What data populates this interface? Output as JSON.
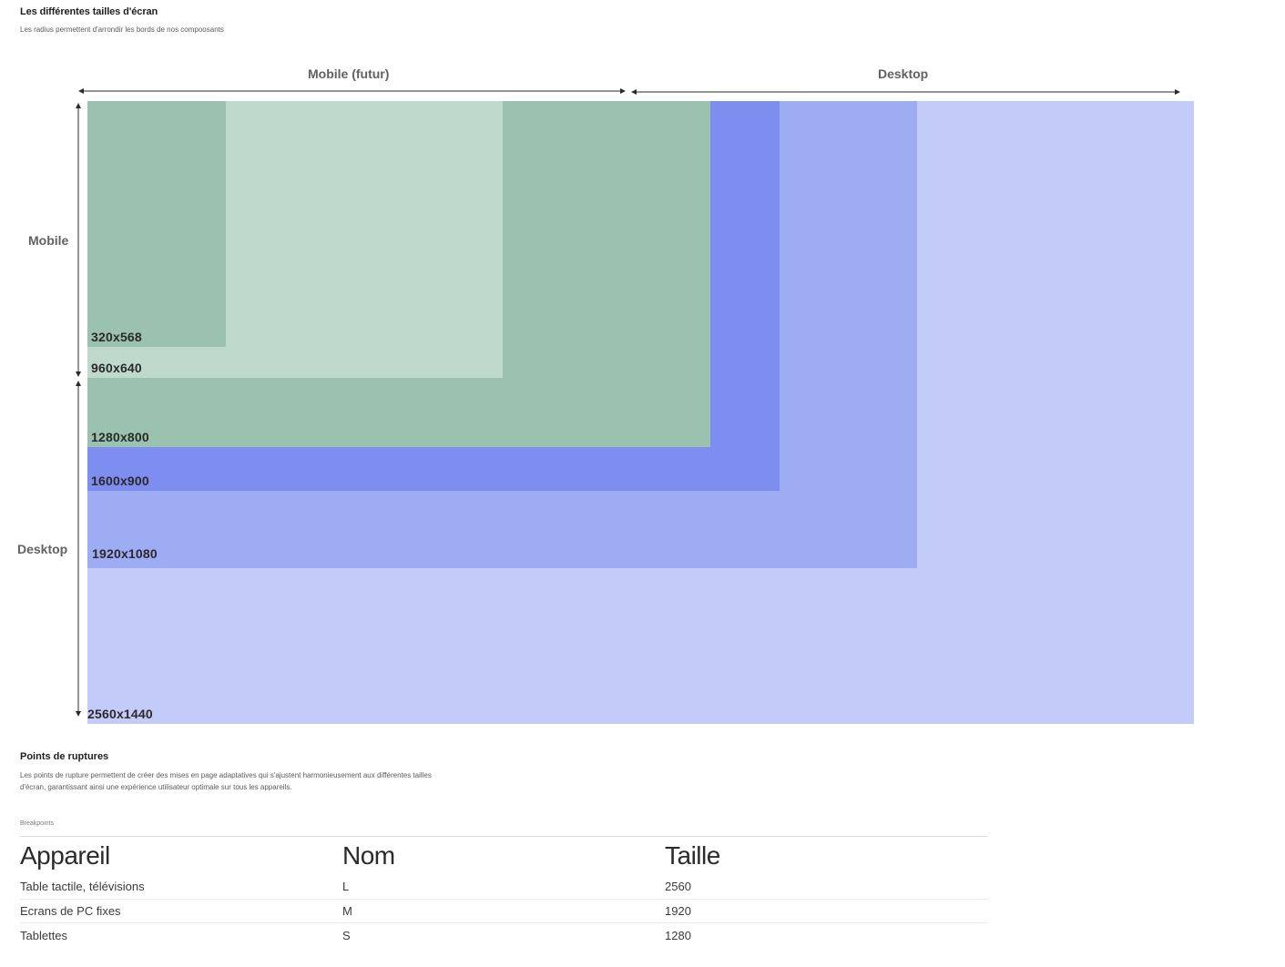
{
  "header": {
    "title": "Les différentes tailles d'écran",
    "subtitle": "Les radius permettent d'arrondir les bords de nos compoosants"
  },
  "diagram": {
    "top_labels": {
      "mobile": "Mobile (futur)",
      "desktop": "Desktop"
    },
    "side_labels": {
      "mobile": "Mobile",
      "desktop": "Desktop"
    },
    "screens": [
      {
        "label": "2560x1440",
        "width": 2560,
        "height": 1440,
        "color": "#c3cbf8"
      },
      {
        "label": "1920x1080",
        "width": 1920,
        "height": 1080,
        "color": "#9eacf3"
      },
      {
        "label": "1600x900",
        "width": 1600,
        "height": 900,
        "color": "#7e8ef0"
      },
      {
        "label": "1280x800",
        "width": 1280,
        "height": 800,
        "color": "#9bc2ae"
      },
      {
        "label": "960x640",
        "width": 960,
        "height": 640,
        "color": "#bfd9cd"
      },
      {
        "label": "320x568",
        "width": 320,
        "height": 568,
        "color": "#9bc2ae"
      }
    ]
  },
  "breakpoints": {
    "title": "Points de ruptures",
    "description": "Les points de rupture permettent de créer des mises en page adaptatives qui s'ajustent harmonieusement aux différentes tailles d'écran, garantissant ainsi une expérience utilisateur optimale sur tous les appareils.",
    "caption": "Breakpoints",
    "columns": [
      "Appareil",
      "Nom",
      "Taille"
    ],
    "rows": [
      {
        "device": "Table tactile, télévisions",
        "name": "L",
        "size": "2560"
      },
      {
        "device": "Ecrans de PC fixes",
        "name": "M",
        "size": "1920"
      },
      {
        "device": "Tablettes",
        "name": "S",
        "size": "1280"
      }
    ]
  }
}
